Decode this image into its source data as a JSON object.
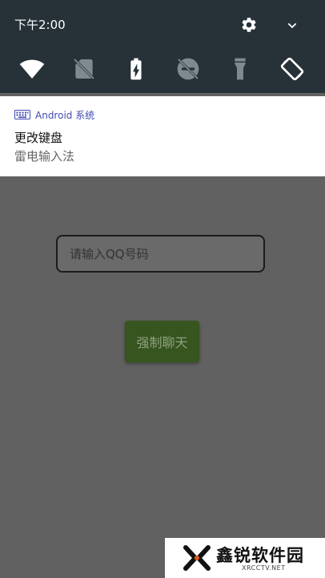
{
  "status_bar": {
    "time": "下午2:00",
    "icons": [
      "gear-icon",
      "chevron-down-icon"
    ]
  },
  "quick_settings": [
    {
      "name": "wifi-icon"
    },
    {
      "name": "no-sim-icon"
    },
    {
      "name": "battery-charging-icon"
    },
    {
      "name": "do-not-disturb-off-icon"
    },
    {
      "name": "flashlight-icon"
    },
    {
      "name": "auto-rotate-icon"
    }
  ],
  "notification": {
    "app_icon": "keyboard-icon",
    "app_name": "Android 系统",
    "title": "更改键盘",
    "text": "雷电输入法"
  },
  "app": {
    "qq_input_placeholder": "请输入QQ号码",
    "qq_input_value": "",
    "chat_button_label": "强制聊天"
  },
  "watermark": {
    "logo_text": "鑫锐软件园",
    "sub_text": "XRCCTV.NET"
  },
  "colors": {
    "shade_bg": "#263238",
    "dim_bg": "#616161",
    "button_bg": "#36551f",
    "app_name": "#3f4bb0"
  }
}
